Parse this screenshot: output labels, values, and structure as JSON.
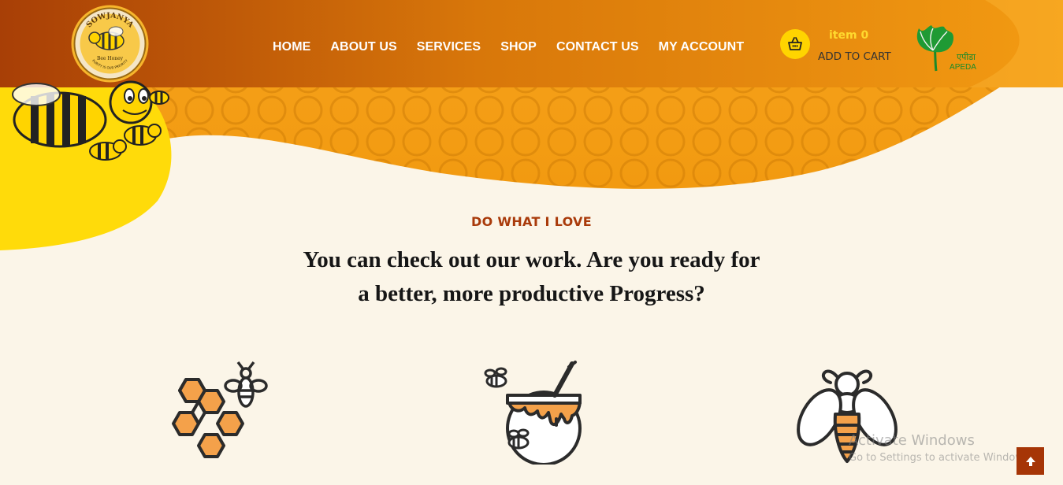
{
  "brand": {
    "logo_arc_text": "SOWJANYA",
    "logo_name": "Bee Honey",
    "logo_tagline": "PURITY IS OUR PRIORITY"
  },
  "nav": {
    "items": [
      {
        "label": "HOME"
      },
      {
        "label": "ABOUT US"
      },
      {
        "label": "SERVICES"
      },
      {
        "label": "SHOP"
      },
      {
        "label": "CONTACT US"
      },
      {
        "label": "MY ACCOUNT"
      }
    ]
  },
  "cart": {
    "count_text": "item 0",
    "label": "ADD TO CART",
    "icon": "basket-icon"
  },
  "partner": {
    "hindi": "एपीडा",
    "name": "APEDA"
  },
  "section": {
    "eyebrow": "DO WHAT I LOVE",
    "headline_line1": "You can check out our work. Are you ready for",
    "headline_line2": "a better, more productive Progress?"
  },
  "features": [
    {
      "icon": "honeycomb-bee-icon"
    },
    {
      "icon": "honey-pot-icon"
    },
    {
      "icon": "bee-icon"
    }
  ],
  "watermark": {
    "line1": "Activate Windows",
    "line2": "Go to Settings to activate Windows."
  },
  "colors": {
    "header_orange": "#d8770a",
    "header_dark": "#a83f06",
    "accent_yellow": "#ffd400",
    "eyebrow_red": "#a93a0a",
    "honey_fill": "#f4a14a",
    "back_to_top": "#a63506"
  }
}
